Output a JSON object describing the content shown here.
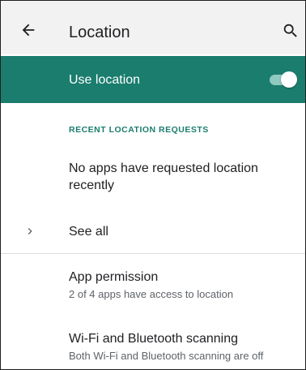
{
  "appbar": {
    "title": "Location",
    "back_icon": "arrow-back-icon",
    "search_icon": "search-icon"
  },
  "use_location": {
    "label": "Use location",
    "enabled": true
  },
  "recent_requests": {
    "header": "RECENT LOCATION REQUESTS",
    "empty_text": "No apps have requested location recently",
    "see_all_label": "See all"
  },
  "preferences": [
    {
      "title": "App permission",
      "summary": "2 of 4 apps have access to location"
    },
    {
      "title": "Wi‑Fi and Bluetooth scanning",
      "summary": "Both Wi‑Fi and Bluetooth scanning are off"
    }
  ],
  "colors": {
    "accent": "#1a7d6e",
    "appbar_bg": "#f2f2f2"
  }
}
